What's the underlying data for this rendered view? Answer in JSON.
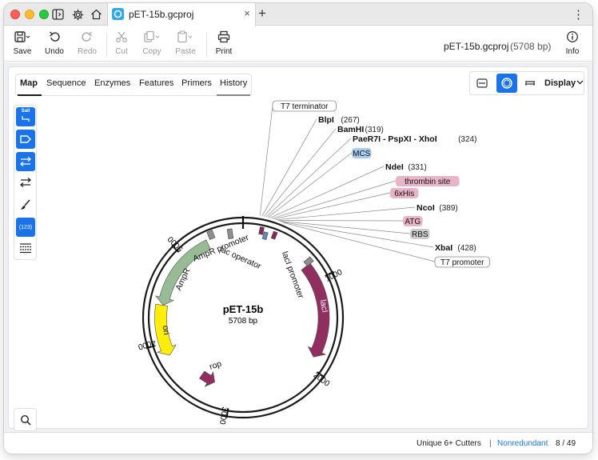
{
  "window": {
    "tab_title": "pET-15b.gcproj",
    "new_tab": "+",
    "close": "×",
    "menu": "⋮"
  },
  "toolbar": {
    "save": "Save",
    "undo": "Undo",
    "redo": "Redo",
    "cut": "Cut",
    "copy": "Copy",
    "paste": "Paste",
    "print": "Print",
    "info": "Info",
    "doc_name": "pET-15b.gcproj",
    "doc_size": "(5708 bp)"
  },
  "view_tabs": [
    "Map",
    "Sequence",
    "Enzymes",
    "Features",
    "Primers",
    "History"
  ],
  "active_tab": "Map",
  "display": {
    "label": "Display"
  },
  "left_tools": {
    "sali_label": "SalI",
    "numbers_label": "(123)"
  },
  "plasmid": {
    "name": "pET-15b",
    "length_label": "5708 bp",
    "length": 5708,
    "ticks": [
      "1000",
      "2000",
      "3000",
      "4000",
      "5000"
    ],
    "enzymes": [
      {
        "name": "BlpI",
        "pos": "(267)"
      },
      {
        "name": "BamHI",
        "pos": "(319)"
      },
      {
        "name": "PaeR7I - PspXI - XhoI",
        "pos": "(324)"
      },
      {
        "name": "NdeI",
        "pos": "(331)"
      },
      {
        "name": "NcoI",
        "pos": "(389)"
      },
      {
        "name": "XbaI",
        "pos": "(428)"
      }
    ],
    "callout_features": [
      {
        "name": "T7 terminator",
        "color": "#ffffff"
      },
      {
        "name": "MCS",
        "color": "#a9ccee"
      },
      {
        "name": "thrombin site",
        "color": "#e8b4c8"
      },
      {
        "name": "6xHis",
        "color": "#e8b4c8"
      },
      {
        "name": "ATG",
        "color": "#e8b4c8"
      },
      {
        "name": "RBS",
        "color": "#cccccc"
      },
      {
        "name": "T7 promoter",
        "color": "#ffffff"
      }
    ],
    "map_features": [
      {
        "name": "AmpR promoter",
        "color": "#8f8f8f"
      },
      {
        "name": "AmpR",
        "color": "#92b890"
      },
      {
        "name": "lac operator",
        "color": "#8f8f8f"
      },
      {
        "name": "lacI promoter",
        "color": "#8f8f8f"
      },
      {
        "name": "lacI",
        "color": "#8b2457"
      },
      {
        "name": "ori",
        "color": "#ffee00"
      },
      {
        "name": "rop",
        "color": "#8b2457"
      }
    ]
  },
  "status": {
    "filter": "Unique 6+ Cutters",
    "separator": "|",
    "mode": "Nonredundant",
    "count": "8 / 49"
  },
  "colors": {
    "accent": "#1a73e8",
    "backbone": "#1a1a1a"
  }
}
